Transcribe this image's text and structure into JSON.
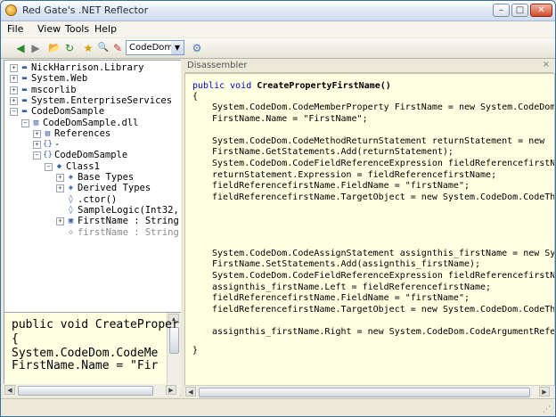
{
  "window": {
    "title": "Red Gate's .NET Reflector",
    "min_glyph": "–",
    "max_glyph": "□",
    "close_glyph": "✕"
  },
  "menu": [
    "File",
    "View",
    "Tools",
    "Help"
  ],
  "toolbar": {
    "back_glyph": "◀",
    "forward_glyph": "▶",
    "open_glyph": "📂",
    "refresh_glyph": "↻",
    "bookmark_glyph": "★",
    "search_glyph": "🔍",
    "disassemble_glyph": "✎",
    "language_value": "CodeDom",
    "combo_arrow": "▼",
    "addin_glyph": "⚙"
  },
  "tree": [
    {
      "label": "NickHarrison.Library",
      "depth": 0,
      "exp": "+",
      "icon": "▬"
    },
    {
      "label": "System.Web",
      "depth": 0,
      "exp": "+",
      "icon": "▬"
    },
    {
      "label": "mscorlib",
      "depth": 0,
      "exp": "+",
      "icon": "▬"
    },
    {
      "label": "System.EnterpriseServices",
      "depth": 0,
      "exp": "+",
      "icon": "▬"
    },
    {
      "label": "CodeDomSample",
      "depth": 0,
      "exp": "−",
      "icon": "▬"
    },
    {
      "label": "CodeDomSample.dll",
      "depth": 1,
      "exp": "−",
      "icon": "▥"
    },
    {
      "label": "References",
      "depth": 2,
      "exp": "+",
      "icon": "▤"
    },
    {
      "label": "-",
      "depth": 2,
      "exp": "+",
      "icon": "{}"
    },
    {
      "label": "CodeDomSample",
      "depth": 2,
      "exp": "−",
      "icon": "{}"
    },
    {
      "label": "Class1",
      "depth": 3,
      "exp": "−",
      "icon": "◆"
    },
    {
      "label": "Base Types",
      "depth": 4,
      "exp": "+",
      "icon": "◈"
    },
    {
      "label": "Derived Types",
      "depth": 4,
      "exp": "+",
      "icon": "◈"
    },
    {
      "label": ".ctor()",
      "depth": 4,
      "exp": "",
      "icon": "◊"
    },
    {
      "label": "SampleLogic(Int32,",
      "depth": 4,
      "exp": "",
      "icon": "◊"
    },
    {
      "label": "FirstName : String",
      "depth": 4,
      "exp": "+",
      "icon": "▣"
    },
    {
      "label": "firstName : String",
      "depth": 4,
      "exp": "",
      "icon": "◇",
      "muted": true
    }
  ],
  "preview": {
    "lines": [
      "public void CreateProper",
      "{",
      "    System.CodeDom.CodeMe",
      "    FirstName.Name = \"Fir"
    ]
  },
  "disassembler": {
    "title": "Disassembler",
    "close_glyph": "×",
    "signature_kw": "public void ",
    "signature_name": "CreatePropertyFirstName()",
    "open_brace": "{",
    "body": [
      "System.CodeDom.CodeMemberProperty FirstName = new System.CodeDom",
      "FirstName.Name = \"FirstName\";",
      "",
      "System.CodeDom.CodeMethodReturnStatement returnStatement =  new ",
      "FirstName.GetStatements.Add(returnStatement);",
      "System.CodeDom.CodeFieldReferenceExpression fieldReferencefirstN",
      "returnStatement.Expression = fieldReferencefirstName;",
      "fieldReferencefirstName.FieldName = \"firstName\";",
      "fieldReferencefirstName.TargetObject = new System.CodeDom.CodeTh",
      "",
      "",
      "",
      "",
      "System.CodeDom.CodeAssignStatement assignthis_firstName = new Sy",
      "FirstName.SetStatements.Add(assignthis_firstName);",
      "System.CodeDom.CodeFieldReferenceExpression fieldReferencefirstN",
      "assignthis_firstName.Left = fieldReferencefirstName;",
      "fieldReferencefirstName.FieldName = \"firstName\";",
      "fieldReferencefirstName.TargetObject = new System.CodeDom.CodeTh",
      "",
      "assignthis_firstName.Right = new System.CodeDom.CodeArgumentRefe"
    ],
    "close_brace": "}"
  },
  "scroll_arrows": {
    "left": "◀",
    "right": "▶",
    "up": "▲",
    "down": "▼"
  }
}
